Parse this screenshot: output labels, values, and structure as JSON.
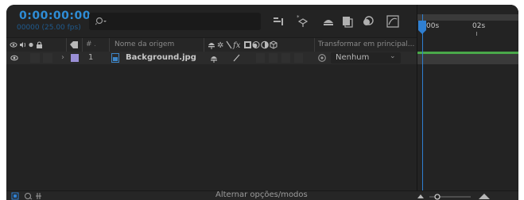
{
  "timecode": "0:00:00:00",
  "fps_line": "00000 (25.00 fps)",
  "search": {
    "icon": "search-icon"
  },
  "columns": {
    "source_name": "Nome da origem",
    "parent": "Transformar em principal..."
  },
  "layer": {
    "number": "1",
    "name": "Background.jpg",
    "parent_value": "Nenhum",
    "label_color": "#9a8fd6"
  },
  "ruler": {
    "tick_0": ":00s",
    "tick_2": "02s"
  },
  "footer": {
    "toggle_label": "Alternar opções/modos"
  },
  "colors": {
    "accent": "#2e8cd6",
    "panel_bg": "#232323",
    "track_bar": "#4aa84a"
  }
}
